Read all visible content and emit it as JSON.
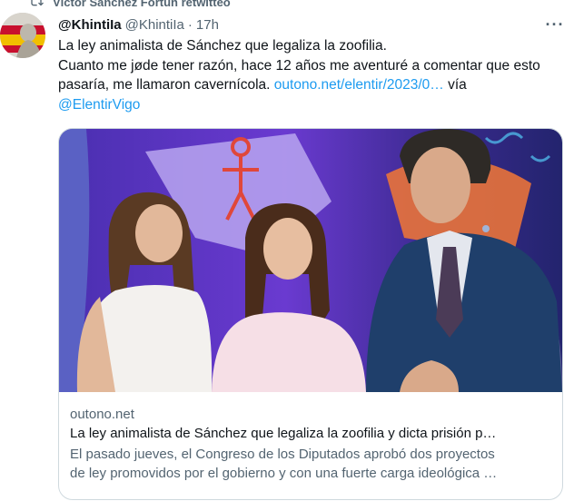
{
  "retweet": {
    "text": "Víctor Sánchez Fortún retwitteó",
    "icon": "retweet-icon"
  },
  "tweet": {
    "display_name": "@KhintiIa",
    "handle": "@KhintiIa",
    "separator": "·",
    "time": "17h",
    "more_label": "···",
    "line1": "La ley animalista de Sánchez que legaliza la zoofilia.",
    "line2_prefix": "Cuanto me jøde tener razón, hace 12 años me aventuré a comentar que esto pasaría, me llamaron cavernícola. ",
    "link_url": "outono.net/elentir/2023/0…",
    "via": " vía",
    "mention": "@ElentirVigo"
  },
  "card": {
    "domain": "outono.net",
    "title": "La ley animalista de Sánchez que legaliza la zoofilia y dicta prisión p…",
    "desc_line1": "El pasado jueves, el Congreso de los Diputados aprobó dos proyectos",
    "desc_line2": "de ley promovidos por el gobierno y con una fuerte carga ideológica …"
  },
  "colors": {
    "text": "#0f1419",
    "secondary": "#536471",
    "link": "#1d9bf0",
    "border": "#cfd9de"
  }
}
